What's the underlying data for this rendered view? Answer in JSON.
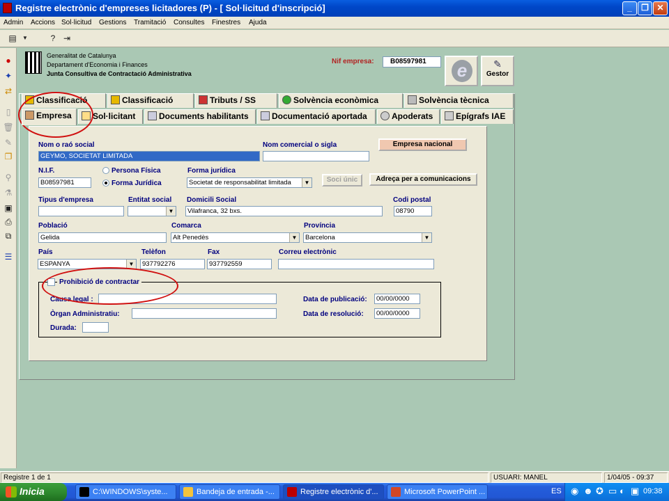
{
  "window": {
    "title": "Registre electrònic d'empreses licitadores (P) - [ Sol·licitud d'inscripció]",
    "controls": [
      "_",
      "❐",
      "✕"
    ]
  },
  "menu": [
    "Admin",
    "Accions",
    "Sol·licitud",
    "Gestions",
    "Tramitació",
    "Consultes",
    "Finestres",
    "Ajuda"
  ],
  "header": {
    "line1": "Generalitat de Catalunya",
    "line2": "Departament d'Economia i Finances",
    "line3": "Junta Consultiva de Contractació Administrativa",
    "nif_label": "Nif empresa:",
    "nif_value": "B08597981",
    "e_label": "e",
    "gestor_label": "Gestor"
  },
  "tabs_row1": [
    "Classificació",
    "Classificació",
    "Tributs / SS",
    "Solvència econòmica",
    "Solvència tècnica"
  ],
  "tabs_row2": [
    "Empresa",
    "Sol·licitant",
    "Documents habilitants",
    "Documentació aportada",
    "Apoderats",
    "Epígrafs IAE"
  ],
  "form": {
    "nom_label": "Nom o raó social",
    "nom_value": "GEYMO, SOCIETAT LIMITADA",
    "comercial_label": "Nom comercial o sigla",
    "comercial_value": "",
    "empresa_nacional": "Empresa nacional",
    "nif_label": "N.I.F.",
    "nif_value": "B08597981",
    "persona_fisica": "Persona Física",
    "forma_juridica_radio": "Forma Jurídica",
    "forma_label": "Forma jurídica",
    "forma_value": "Societat de responsabilitat limitada",
    "soci_unic": "Soci únic",
    "adreca_btn": "Adreça per a comunicacions",
    "tipus_label": "Tipus d'empresa",
    "tipus_value": "",
    "entitat_label": "Entitat social",
    "entitat_value": "",
    "domicili_label": "Domicili Social",
    "domicili_value": "Vilafranca, 32 bxs.",
    "codi_label": "Codi postal",
    "codi_value": "08790",
    "poblacio_label": "Població",
    "poblacio_value": "Gelida",
    "comarca_label": "Comarca",
    "comarca_value": "Alt Penedès",
    "provincia_label": "Província",
    "provincia_value": "Barcelona",
    "pais_label": "País",
    "pais_value": "ESPANYA",
    "telefon_label": "Telèfon",
    "telefon_value": "937792276",
    "fax_label": "Fax",
    "fax_value": "937792559",
    "correu_label": "Correu electrònic",
    "correu_value": "",
    "prohibicio_label": "Prohibició de contractar",
    "causa_label": "Causa legal :",
    "causa_value": "",
    "organ_label": "Òrgan Administratiu:",
    "organ_value": "",
    "durada_label": "Durada:",
    "durada_value": "",
    "publicacio_label": "Data de publicació:",
    "publicacio_value": "00/00/0000",
    "resolucio_label": "Data de resolució:",
    "resolucio_value": "00/00/0000"
  },
  "status": {
    "registre": "Registre 1 de 1",
    "usuari": "USUARI: MANEL",
    "datetime": "1/04/05 - 09:37"
  },
  "taskbar": {
    "start": "Inicia",
    "tasks": [
      "C:\\WINDOWS\\syste...",
      "Bandeja de entrada -...",
      "Registre electrònic d'...",
      "Microsoft PowerPoint ..."
    ],
    "lang": "ES",
    "clock": "09:38"
  },
  "colors": {
    "background": "#aac8b4",
    "panel": "#ece9d8",
    "label_blue": "#00007f",
    "nif_red": "#b22222",
    "annotation_red": "#d01010",
    "selection": "#3169c6"
  }
}
